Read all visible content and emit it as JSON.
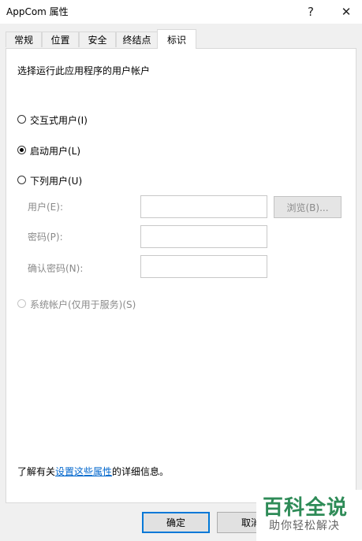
{
  "window": {
    "title": "AppCom 属性",
    "help": "?",
    "close": "✕"
  },
  "tabs": [
    {
      "label": "常规"
    },
    {
      "label": "位置"
    },
    {
      "label": "安全"
    },
    {
      "label": "终结点"
    },
    {
      "label": "标识"
    }
  ],
  "identity": {
    "heading": "选择运行此应用程序的用户帐户",
    "options": [
      {
        "label": "交互式用户(I)"
      },
      {
        "label": "启动用户(L)"
      },
      {
        "label": "下列用户(U)"
      }
    ],
    "selected": "启动用户(L)",
    "fields": {
      "user_label": "用户(E):",
      "password_label": "密码(P):",
      "confirm_label": "确认密码(N):",
      "user_value": "",
      "password_value": "",
      "confirm_value": ""
    },
    "browse_label": "浏览(B)...",
    "system_account": "系统帐户(仅用于服务)(S)",
    "footer": {
      "before": "了解有关",
      "link": "设置这些属性",
      "after": "的详细信息。"
    }
  },
  "buttons": {
    "ok": "确定",
    "cancel": "取消"
  },
  "watermark": {
    "main": "百科全说",
    "sub": "助你轻松解决"
  }
}
